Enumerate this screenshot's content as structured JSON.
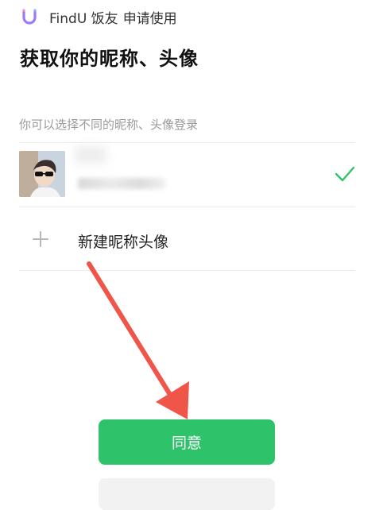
{
  "header": {
    "app_name": "FindU 饭友",
    "request_label": "申请使用",
    "app_icon": "findu-logo-icon",
    "accent_color": "#9b7bf5"
  },
  "title": "获取你的昵称、头像",
  "subtitle": "你可以选择不同的昵称、头像登录",
  "accounts": [
    {
      "avatar": "avatar-photo",
      "selected": true,
      "name": "",
      "check_icon": "checkmark-icon",
      "check_color": "#2ec36b"
    }
  ],
  "new_profile": {
    "icon": "plus-icon",
    "label": "新建昵称头像"
  },
  "buttons": {
    "agree_label": "同意",
    "agree_color": "#2ec36b"
  },
  "annotation": {
    "arrow_color": "#f0554a"
  }
}
